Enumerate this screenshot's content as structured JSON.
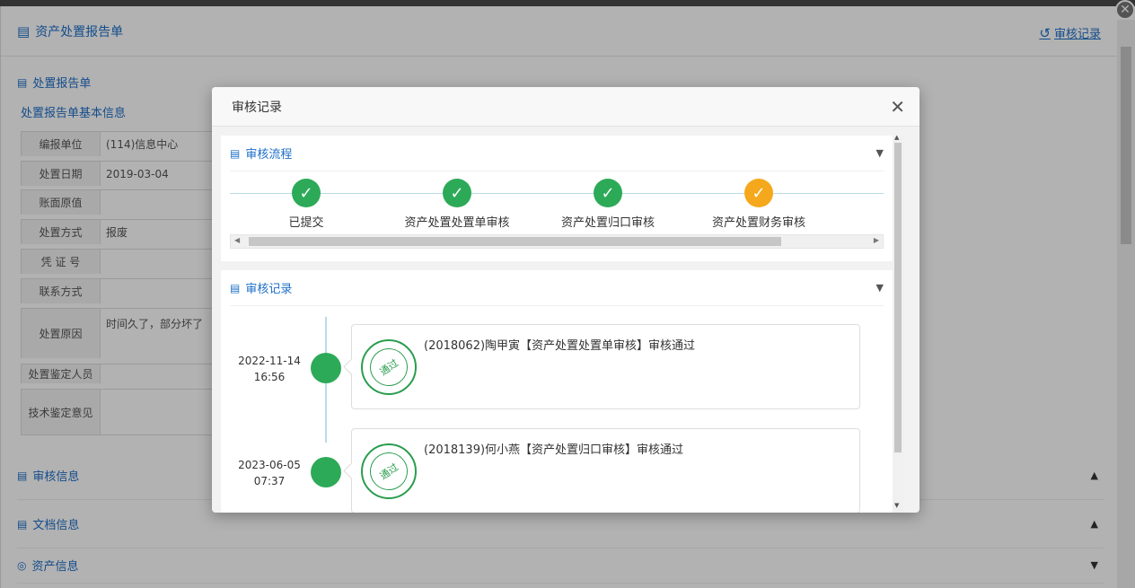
{
  "page": {
    "title": "资产处置报告单",
    "audit_link": "审核记录",
    "close_glyph": "✕"
  },
  "report": {
    "section_title": "处置报告单",
    "basic_info_title": "处置报告单基本信息",
    "fields": [
      {
        "label": "编报单位",
        "value": "(114)信息中心"
      },
      {
        "label": "处置日期",
        "value": "2019-03-04"
      },
      {
        "label": "账面原值",
        "value": ""
      },
      {
        "label": "处置方式",
        "value": "报废"
      },
      {
        "label": "凭 证 号",
        "value": ""
      },
      {
        "label": "联系方式",
        "value": ""
      },
      {
        "label": "处置原因",
        "value": "时间久了，部分坏了"
      },
      {
        "label": "处置鉴定人员",
        "value": ""
      },
      {
        "label": "技术鉴定意见",
        "value": ""
      }
    ]
  },
  "bottom_sections": [
    {
      "label": "审核信息",
      "arrow": "▲"
    },
    {
      "label": "文档信息",
      "arrow": "▲"
    },
    {
      "label": "资产信息",
      "arrow": "▼"
    }
  ],
  "modal": {
    "title": "审核记录",
    "close_glyph": "✕",
    "flow": {
      "title": "审核流程",
      "steps": [
        {
          "label": "已提交",
          "status": "done",
          "color": "#2daa57"
        },
        {
          "label": "资产处置处置单审核",
          "status": "done",
          "color": "#2daa57"
        },
        {
          "label": "资产处置归口审核",
          "status": "done",
          "color": "#2daa57"
        },
        {
          "label": "资产处置财务审核",
          "status": "current",
          "color": "#f5a81c"
        }
      ]
    },
    "records": {
      "title": "审核记录",
      "items": [
        {
          "date": "2022-11-14",
          "time": "16:56",
          "text": "(2018062)陶甲寅【资产处置处置单审核】审核通过",
          "stamp": "通过"
        },
        {
          "date": "2023-06-05",
          "time": "07:37",
          "text": "(2018139)何小燕【资产处置归口审核】审核通过",
          "stamp": "通过"
        }
      ]
    }
  }
}
